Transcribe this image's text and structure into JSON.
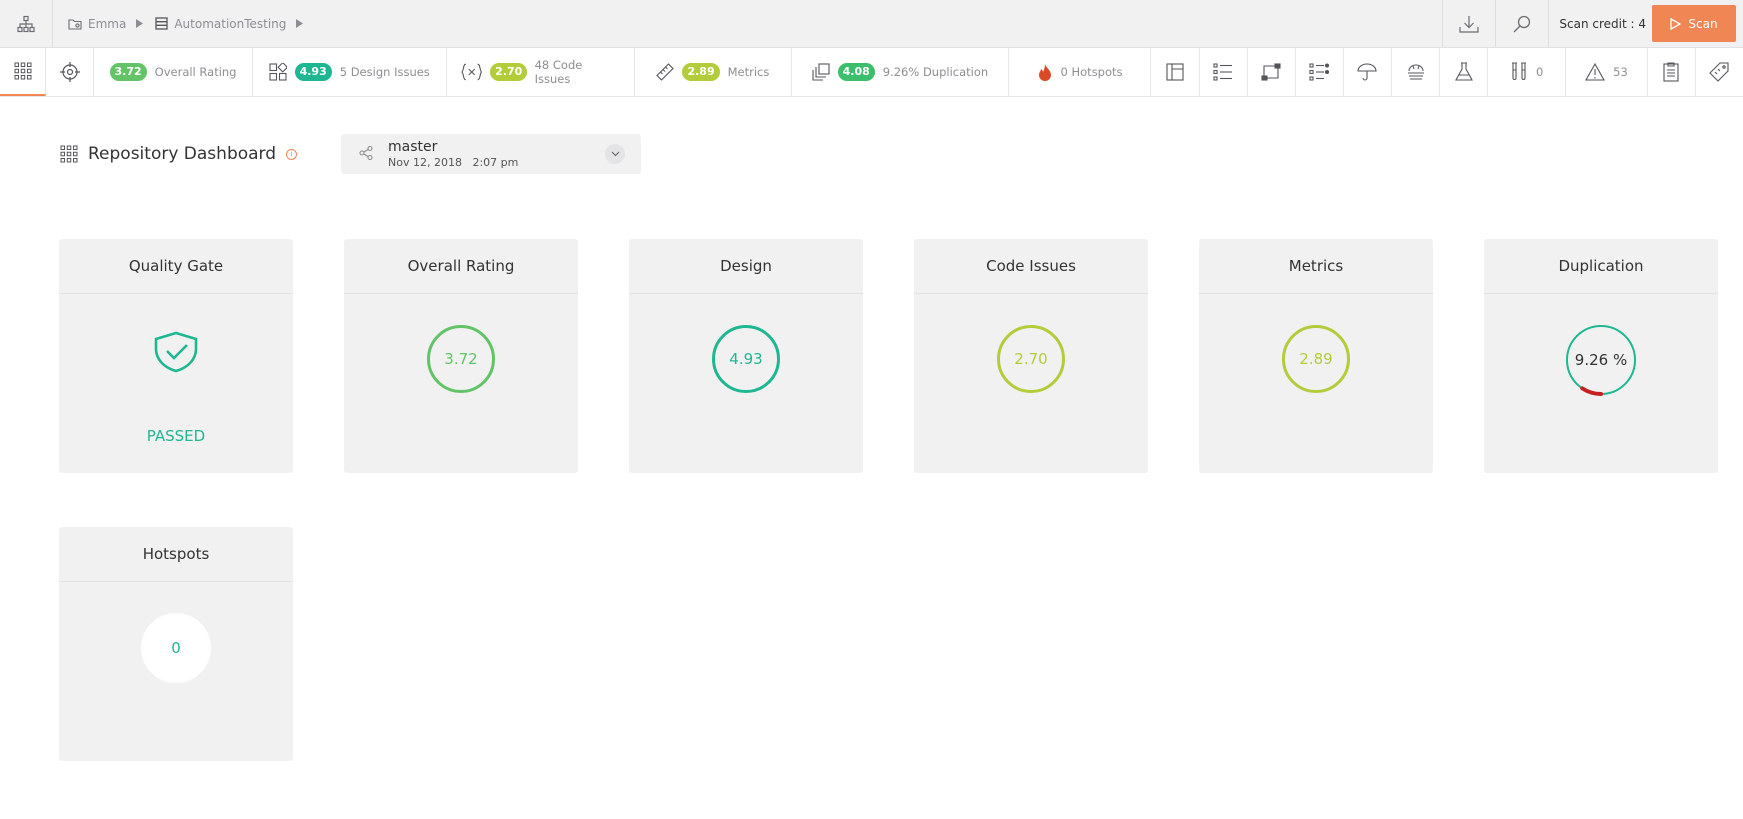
{
  "topbar": {
    "breadcrumb": [
      {
        "label": "Emma",
        "icon": "folder-icon"
      },
      {
        "label": "AutomationTesting",
        "icon": "repository-icon"
      }
    ],
    "scan_credit": "Scan credit : 4",
    "scan_button": "Scan"
  },
  "nav": {
    "overall": {
      "score": "3.72",
      "label": "Overall Rating",
      "color": "#62c466"
    },
    "design": {
      "score": "4.93",
      "label": "5 Design Issues",
      "color": "#1fb791"
    },
    "code": {
      "score": "2.70",
      "label": "48 Code Issues",
      "color": "#b2cc3a"
    },
    "metrics": {
      "score": "2.89",
      "label": "Metrics",
      "color": "#b2cc3a"
    },
    "duplication": {
      "score": "4.08",
      "label": "9.26% Duplication",
      "color": "#3cbf6d"
    },
    "hotspots": {
      "label": "0 Hotspots"
    },
    "tests": {
      "count": "0"
    },
    "warnings": {
      "count": "53"
    }
  },
  "dashboard": {
    "title": "Repository Dashboard",
    "branch": {
      "name": "master",
      "date": "Nov 12, 2018   2:07 pm"
    }
  },
  "cards": {
    "quality_gate": {
      "title": "Quality Gate",
      "status": "PASSED",
      "color": "#1fb791"
    },
    "overall": {
      "title": "Overall Rating",
      "value": "3.72",
      "color": "#62c466"
    },
    "design": {
      "title": "Design",
      "value": "4.93",
      "color": "#1fb791"
    },
    "code_issues": {
      "title": "Code Issues",
      "value": "2.70",
      "color": "#b2cc3a"
    },
    "metrics": {
      "title": "Metrics",
      "value": "2.89",
      "color": "#b2cc3a"
    },
    "duplication": {
      "title": "Duplication",
      "value": "9.26 %",
      "percent": 9.26,
      "color": "#1fb791",
      "highlight_color": "#c62020"
    },
    "hotspots": {
      "title": "Hotspots",
      "value": "0"
    }
  }
}
